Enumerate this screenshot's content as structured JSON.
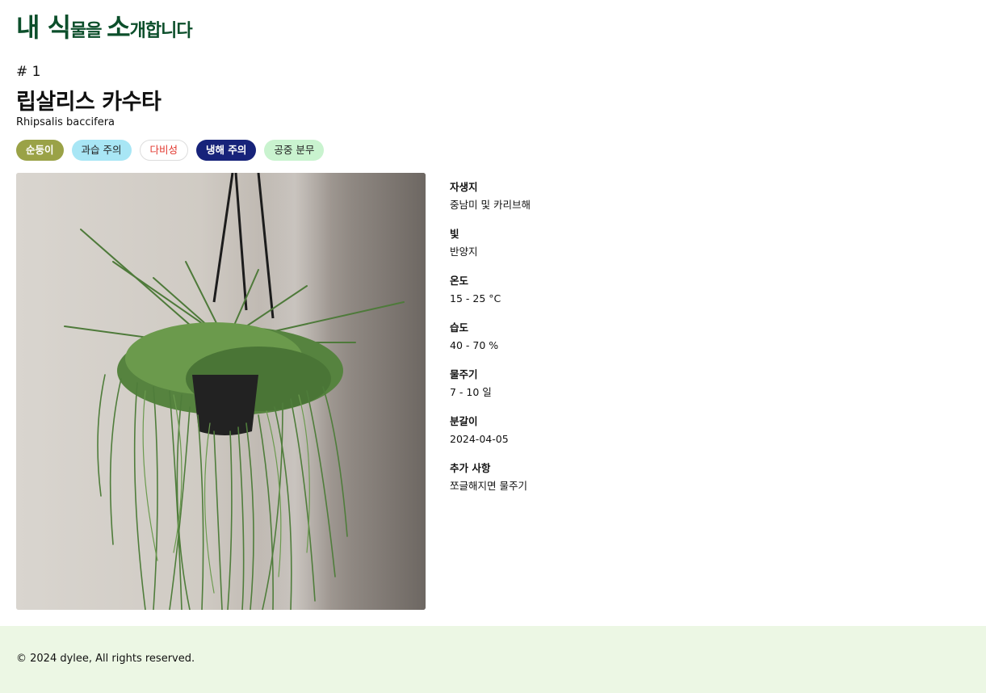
{
  "header": {
    "title_parts": [
      "내 식",
      "물을 ",
      "소",
      "개합니다"
    ]
  },
  "plant": {
    "number": "# 1",
    "name": "립살리스 카수타",
    "scientific_name": "Rhipsalis baccifera",
    "tags": [
      "순둥이",
      "과습 주의",
      "다비성",
      "냉해 주의",
      "공중 분무"
    ],
    "tag_colors": [
      "#9aa247",
      "#a8e6f5",
      "#ffffff",
      "#17237a",
      "#c9f3cf"
    ],
    "photo_alt": "hanging-plant-photo",
    "info": [
      {
        "label": "자생지",
        "value": "중남미 및 카리브해"
      },
      {
        "label": "빛",
        "value": "반양지"
      },
      {
        "label": "온도",
        "value": "15 - 25 °C"
      },
      {
        "label": "습도",
        "value": "40 - 70 %"
      },
      {
        "label": "물주기",
        "value": "7 - 10 일"
      },
      {
        "label": "분갈이",
        "value": "2024-04-05"
      },
      {
        "label": "추가 사항",
        "value": "쪼글해지면 물주기"
      }
    ]
  },
  "footer": {
    "text": "© 2024 dylee, All rights reserved."
  },
  "colors": {
    "brand": "#0c4f2b",
    "footer_bg": "#ecf7e4"
  }
}
